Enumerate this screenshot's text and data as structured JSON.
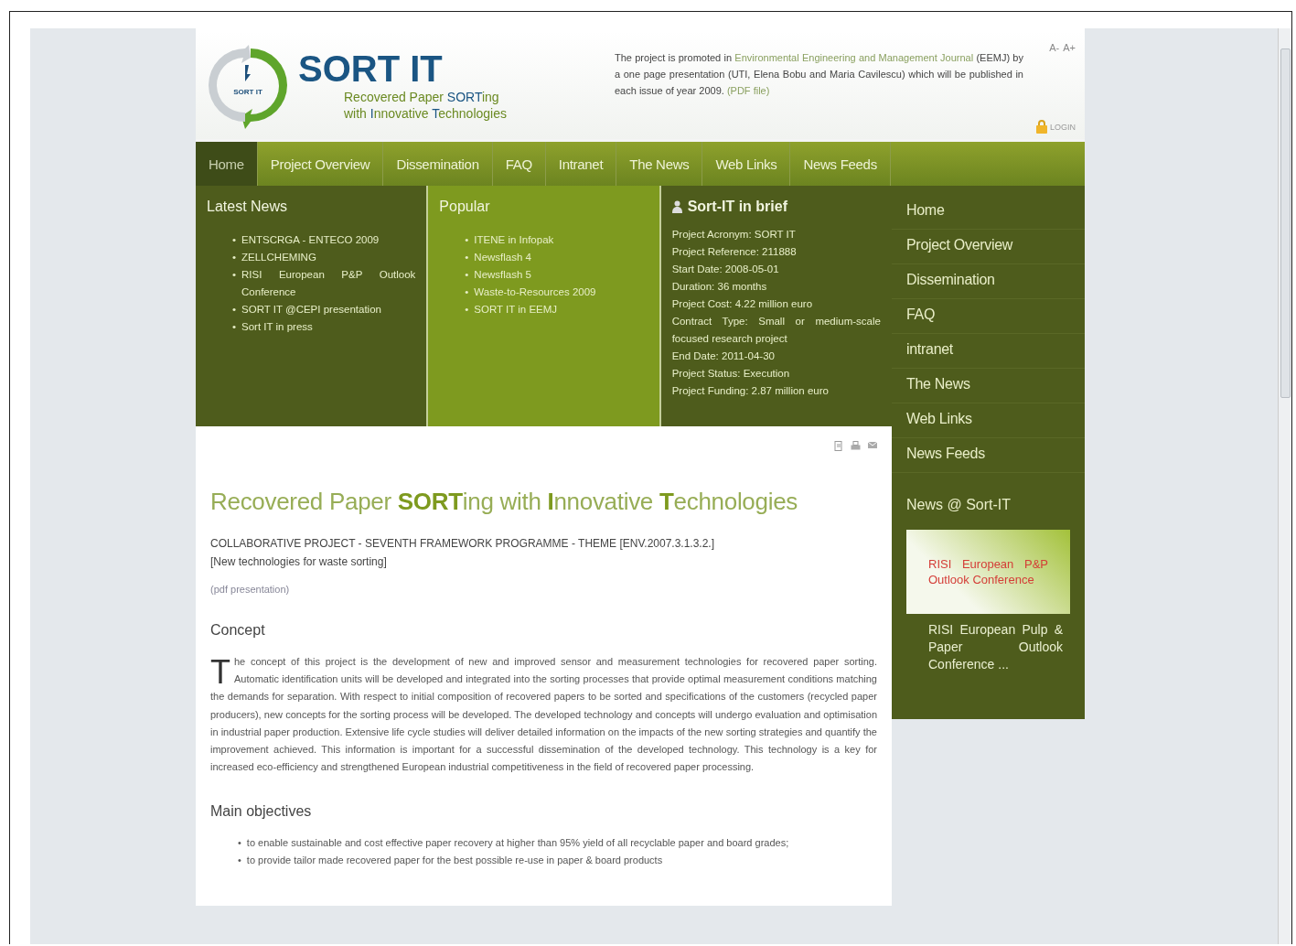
{
  "header": {
    "logo_badge": "SORT IT",
    "title": "SORT IT",
    "tagline_1": "Recovered Paper **SORT**ing",
    "tagline_2": "with **I**nnovative **T**echnologies",
    "promo": [
      {
        "kind": "text",
        "text": "The project is promoted in "
      },
      {
        "kind": "link",
        "text": "Environmental Engineering and Management Journal"
      },
      {
        "kind": "text",
        "text": " (EEMJ) by a one page presentation (UTI, Elena Bobu and Maria Cavilescu) which will be published in each issue of year 2009. "
      },
      {
        "kind": "link",
        "text": "(PDF file)"
      }
    ],
    "font_controls": [
      "A-",
      "A+"
    ],
    "login": "LOGIN"
  },
  "nav": [
    {
      "label": "Home",
      "selected": true
    },
    {
      "label": "Project Overview",
      "selected": false
    },
    {
      "label": "Dissemination",
      "selected": false
    },
    {
      "label": "FAQ",
      "selected": false
    },
    {
      "label": "Intranet",
      "selected": false
    },
    {
      "label": "The News",
      "selected": false
    },
    {
      "label": "Web Links",
      "selected": false
    },
    {
      "label": "News Feeds",
      "selected": false
    }
  ],
  "latest_news": {
    "title": "Latest News",
    "items": [
      {
        "bullet": "•",
        "text": "ENTSCRGA - ENTECO 2009"
      },
      {
        "bullet": "•",
        "text": "ZELLCHEMING"
      },
      {
        "bullet": "•",
        "text": "RISI European P&P Outlook Conference"
      },
      {
        "bullet": "•",
        "text": "SORT IT @CEPI presentation"
      },
      {
        "bullet": "•",
        "text": "Sort IT in press"
      }
    ]
  },
  "popular": {
    "title": "Popular",
    "items": [
      {
        "bullet": "•",
        "text": "ITENE in Infopak"
      },
      {
        "bullet": "•",
        "text": "Newsflash 4"
      },
      {
        "bullet": "•",
        "text": "Newsflash 5"
      },
      {
        "bullet": "•",
        "text": "Waste-to-Resources 2009"
      },
      {
        "bullet": "•",
        "text": "SORT IT in EEMJ"
      }
    ]
  },
  "brief": {
    "title": "Sort-IT in brief",
    "lines": [
      "Project Acronym: SORT IT",
      "Project Reference: 211888",
      "Start Date: 2008-05-01",
      "Duration: 36 months",
      "Project Cost: 4.22 million euro",
      "Contract Type: Small or medium-scale focused research project",
      "End Date: 2011-04-30",
      "Project Status: Execution",
      "Project Funding: 2.87 million euro"
    ]
  },
  "sidebar": {
    "menu": [
      {
        "label": "Home"
      },
      {
        "label": "Project Overview"
      },
      {
        "label": "Dissemination"
      },
      {
        "label": "FAQ"
      },
      {
        "label": "intranet"
      },
      {
        "label": "The News"
      },
      {
        "label": "Web Links"
      },
      {
        "label": "News Feeds"
      }
    ],
    "news_title": "News @ Sort-IT",
    "banner": "RISI European P&P Outlook Conference",
    "caption": "RISI European Pulp & Paper Outlook Conference ..."
  },
  "article": {
    "title": "Recovered Paper **SORT**ing with **I**nnovative **T**echnologies",
    "subtitle_1": "COLLABORATIVE PROJECT - SEVENTH FRAMEWORK PROGRAMME - THEME [ENV.2007.3.1.3.2.]",
    "subtitle_2": "[New technologies for waste sorting]",
    "pdf_link": "(pdf presentation)",
    "concept_title": "Concept",
    "drop_cap": "T",
    "concept_text": "he concept of this project is the development of new and improved sensor and measurement technologies for recovered paper sorting. Automatic identification units will be developed and integrated into the sorting processes that provide optimal measurement conditions matching the demands for separation. With respect to initial composition of recovered papers to be sorted and specifications of the customers (recycled paper producers), new concepts for the sorting process will be developed. The developed technology and concepts will undergo evaluation and optimisation in industrial paper production. Extensive life cycle studies will deliver detailed information on the impacts of the new sorting strategies and quantify the improvement achieved. This information is important for a successful dissemination of the developed technology. This technology is a key for increased eco-efficiency and strengthened European industrial competitiveness in the field of recovered paper processing.",
    "objectives_title": "Main objectives",
    "objectives": [
      {
        "bullet": "•",
        "text": "to enable sustainable and cost effective paper recovery at higher than 95% yield of all recyclable paper and board grades;"
      },
      {
        "bullet": "•",
        "text": "to provide tailor made recovered paper for the best possible re-use in paper & board products"
      }
    ]
  }
}
